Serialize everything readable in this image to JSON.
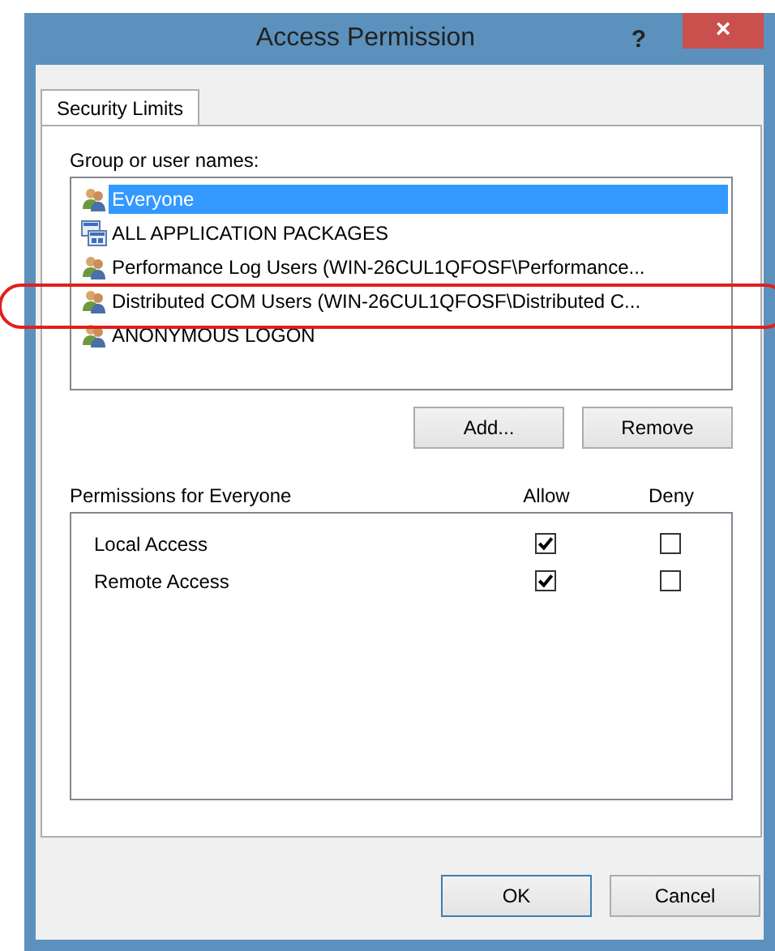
{
  "window": {
    "title": "Access Permission",
    "help": "?",
    "close": "×"
  },
  "tabs": [
    {
      "label": "Security Limits",
      "selected": true
    }
  ],
  "group_label": "Group or user names:",
  "users": [
    {
      "name": "Everyone",
      "kind": "group",
      "selected": true
    },
    {
      "name": "ALL APPLICATION PACKAGES",
      "kind": "packages",
      "selected": false
    },
    {
      "name": "Performance Log Users (WIN-26CUL1QFOSF\\Performance...",
      "kind": "group",
      "selected": false
    },
    {
      "name": "Distributed COM Users (WIN-26CUL1QFOSF\\Distributed C...",
      "kind": "group",
      "selected": false
    },
    {
      "name": "ANONYMOUS LOGON",
      "kind": "group",
      "selected": false
    }
  ],
  "list_buttons": [
    "Add...",
    "Remove"
  ],
  "permissions": {
    "title": "Permissions for Everyone",
    "columns": [
      "Allow",
      "Deny"
    ],
    "rows": [
      {
        "name": "Local Access",
        "allow": true,
        "deny": false
      },
      {
        "name": "Remote Access",
        "allow": true,
        "deny": false
      }
    ]
  },
  "buttons": [
    {
      "label": "OK",
      "default": true
    },
    {
      "label": "Cancel",
      "default": false
    }
  ]
}
